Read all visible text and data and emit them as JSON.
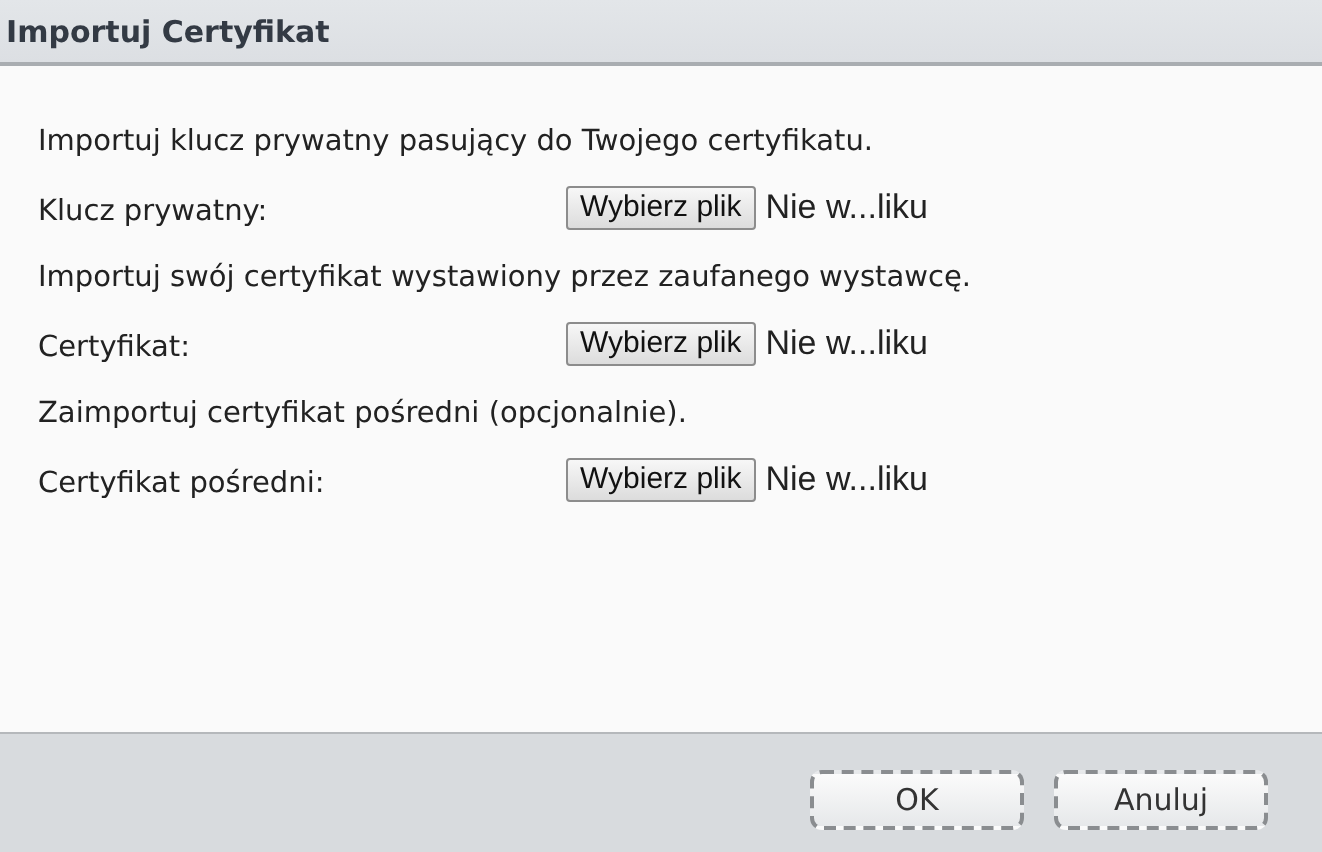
{
  "window": {
    "title": "Importuj Certyfikat"
  },
  "rows": [
    {
      "kind": "text",
      "text": "Importuj klucz prywatny pasujący do Twojego certyfikatu."
    },
    {
      "kind": "file",
      "label": "Klucz prywatny:",
      "button": "Wybierz plik",
      "status": "Nie w...liku"
    },
    {
      "kind": "text",
      "text": "Importuj swój certyfikat wystawiony przez zaufanego wystawcę."
    },
    {
      "kind": "file",
      "label": "Certyfikat:",
      "button": "Wybierz plik",
      "status": "Nie w...liku"
    },
    {
      "kind": "text",
      "text": "Zaimportuj certyfikat pośredni (opcjonalnie)."
    },
    {
      "kind": "file",
      "label": "Certyfikat pośredni:",
      "button": "Wybierz plik",
      "status": "Nie w...liku"
    }
  ],
  "buttons": [
    "OK",
    "Anuluj"
  ]
}
